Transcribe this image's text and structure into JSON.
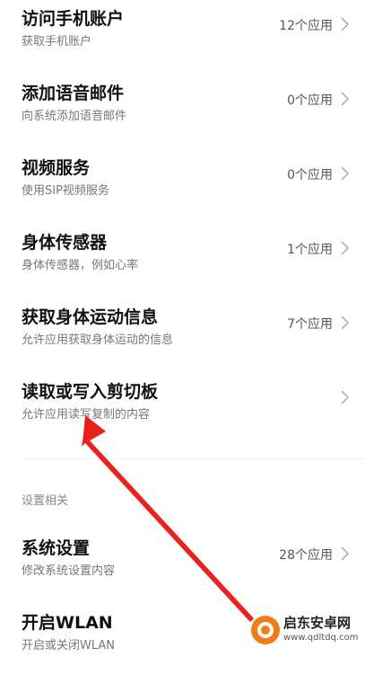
{
  "rows": [
    {
      "title": "访问手机账户",
      "subtitle": "获取手机账户",
      "count": "12个应用"
    },
    {
      "title": "添加语音邮件",
      "subtitle": "向系统添加语音邮件",
      "count": "0个应用"
    },
    {
      "title": "视频服务",
      "subtitle": "使用SIP视频服务",
      "count": "0个应用"
    },
    {
      "title": "身体传感器",
      "subtitle": "身体传感器，例如心率",
      "count": "1个应用"
    },
    {
      "title": "获取身体运动信息",
      "subtitle": "允许应用获取身体运动的信息",
      "count": "7个应用"
    },
    {
      "title": "读取或写入剪切板",
      "subtitle": "允许应用读写复制的内容",
      "count": ""
    }
  ],
  "section_header": "设置相关",
  "rows2": [
    {
      "title": "系统设置",
      "subtitle": "修改系统设置内容",
      "count": "28个应用"
    },
    {
      "title": "开启WLAN",
      "subtitle": "开启或关闭WLAN",
      "count": ""
    }
  ],
  "watermark": {
    "name": "启东安卓网",
    "url": "www.qdltdq.com"
  },
  "colors": {
    "annotation_arrow": "#e8231f",
    "watermark_logo": "#f07c1a"
  }
}
